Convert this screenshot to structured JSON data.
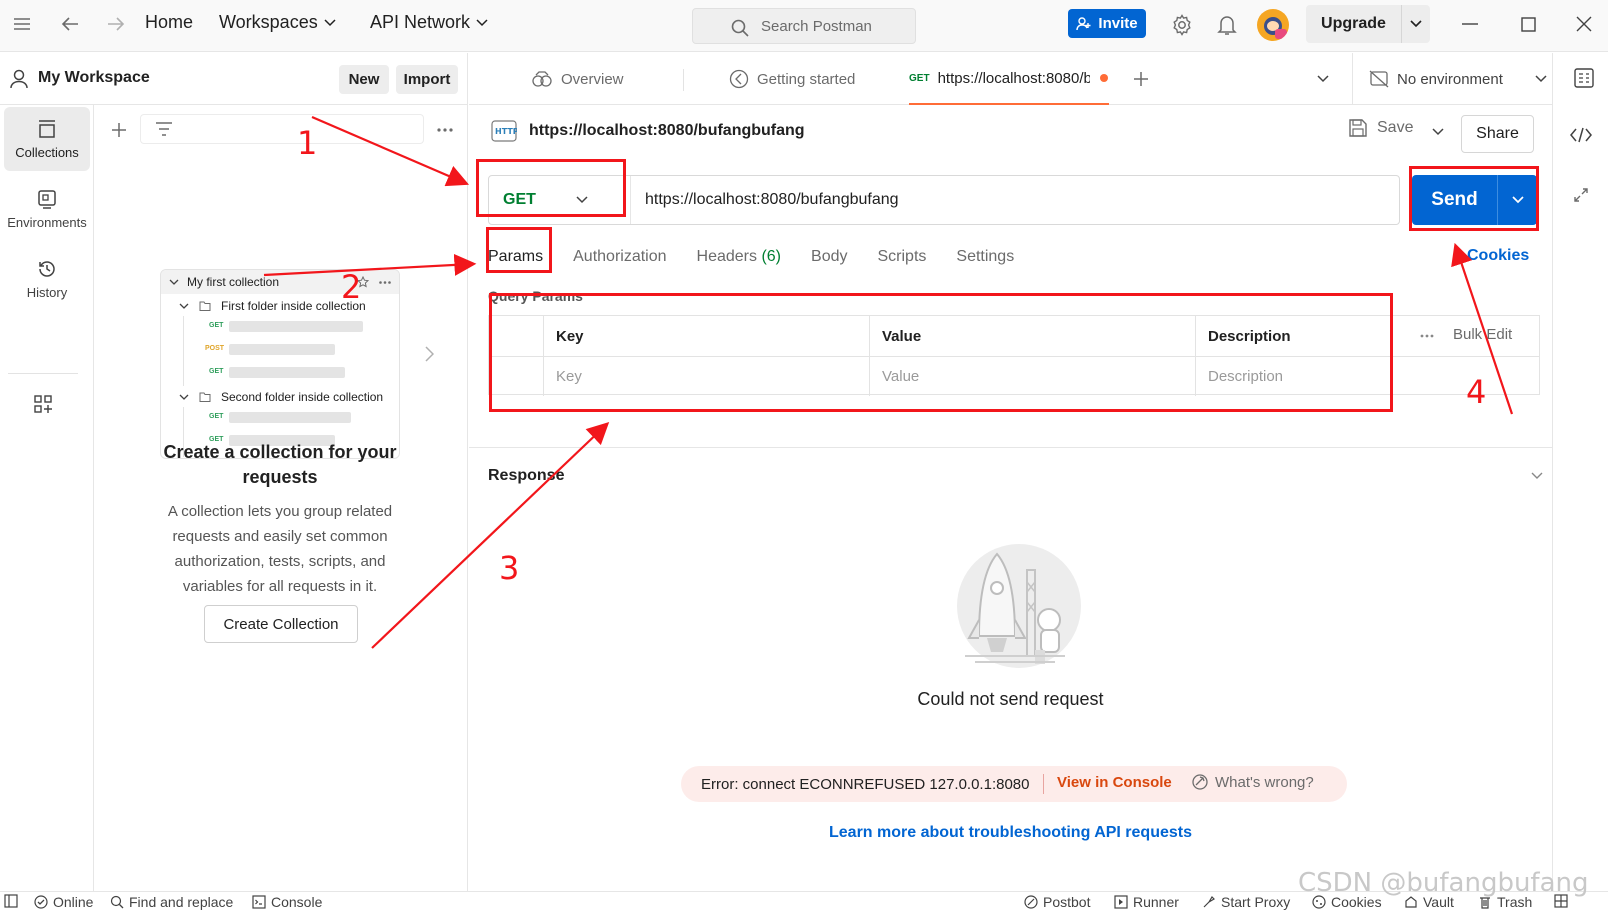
{
  "topbar": {
    "home": "Home",
    "workspaces": "Workspaces",
    "api_network": "API Network",
    "search_placeholder": "Search Postman",
    "invite": "Invite",
    "upgrade": "Upgrade"
  },
  "sidebar": {
    "workspace_name": "My Workspace",
    "new_label": "New",
    "import_label": "Import",
    "rail": [
      {
        "label": "Collections",
        "icon": "collections-icon"
      },
      {
        "label": "Environments",
        "icon": "environments-icon"
      },
      {
        "label": "History",
        "icon": "history-icon"
      }
    ],
    "preview": {
      "collection": "My first collection",
      "folder1": "First folder inside collection",
      "folder2": "Second folder inside collection",
      "methods": [
        "GET",
        "POST",
        "GET",
        "GET",
        "GET"
      ]
    },
    "empty_title": "Create a collection for your requests",
    "empty_desc": "A collection lets you group related requests and easily set common authorization, tests, scripts, and variables for all requests in it.",
    "create_button": "Create Collection"
  },
  "tabs": {
    "overview": "Overview",
    "getting_started": "Getting started",
    "active_method": "GET",
    "active_title": "https://localhost:8080/b",
    "no_environment": "No environment"
  },
  "request": {
    "title": "https://localhost:8080/bufangbufang",
    "save": "Save",
    "share": "Share",
    "method": "GET",
    "url": "https://localhost:8080/bufangbufang",
    "send": "Send",
    "cookies": "Cookies",
    "subtabs": {
      "params": "Params",
      "authorization": "Authorization",
      "headers": "Headers",
      "headers_count": "(6)",
      "body": "Body",
      "scripts": "Scripts",
      "settings": "Settings"
    },
    "query_params_label": "Query Params",
    "columns": [
      "Key",
      "Value",
      "Description"
    ],
    "placeholders": [
      "Key",
      "Value",
      "Description"
    ],
    "bulk_edit": "Bulk Edit"
  },
  "response": {
    "label": "Response",
    "could_not_send": "Could not send request",
    "error": "Error: connect ECONNREFUSED 127.0.0.1:8080",
    "view_console": "View in Console",
    "whats_wrong": "What's wrong?",
    "learn_more": "Learn more about troubleshooting API requests"
  },
  "annotations": [
    "1",
    "2",
    "3",
    "4"
  ],
  "statusbar": {
    "online": "Online",
    "find_replace": "Find and replace",
    "console": "Console",
    "postbot": "Postbot",
    "runner": "Runner",
    "start_proxy": "Start Proxy",
    "cookies": "Cookies",
    "vault": "Vault",
    "trash": "Trash"
  },
  "watermark": "CSDN @bufangbufang",
  "colors": {
    "accent": "#0265d2",
    "annotation": "#f2161b",
    "get_method": "#007f31",
    "error_link": "#d9480f"
  }
}
